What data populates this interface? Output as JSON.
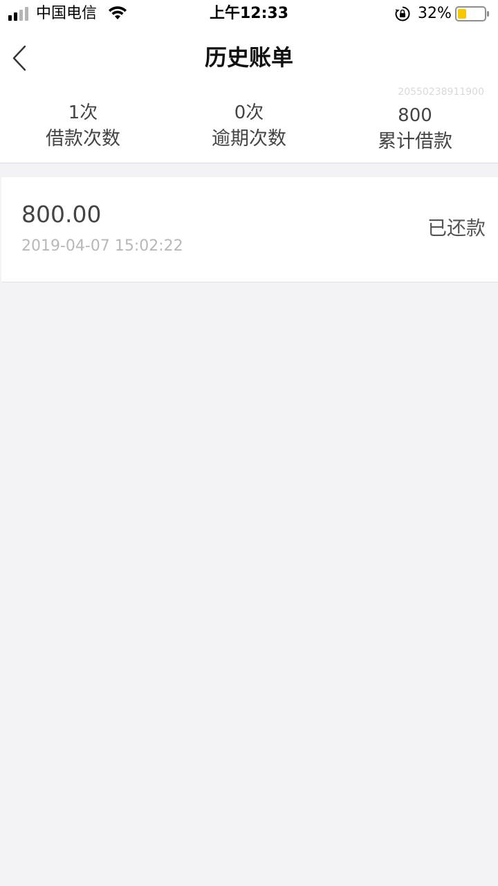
{
  "status_bar": {
    "carrier": "中国电信",
    "time": "上午12:33",
    "battery_percent": "32%",
    "battery_level": 0.32,
    "signal_icon": "signal-bars-icon",
    "wifi_icon": "wifi-icon",
    "lock_icon": "rotation-lock-icon"
  },
  "nav": {
    "title": "历史账单",
    "back_icon": "chevron-left-icon"
  },
  "summary": {
    "account_id": "20550238911900",
    "stats": [
      {
        "value": "1次",
        "label": "借款次数"
      },
      {
        "value": "0次",
        "label": "逾期次数"
      },
      {
        "value": "800",
        "label": "累计借款"
      }
    ]
  },
  "bills": [
    {
      "amount": "800.00",
      "time": "2019-04-07 15:02:22",
      "status": "已还款"
    }
  ],
  "colors": {
    "background": "#f2f2f7",
    "card": "#ffffff",
    "battery_fill": "#f7c800"
  }
}
